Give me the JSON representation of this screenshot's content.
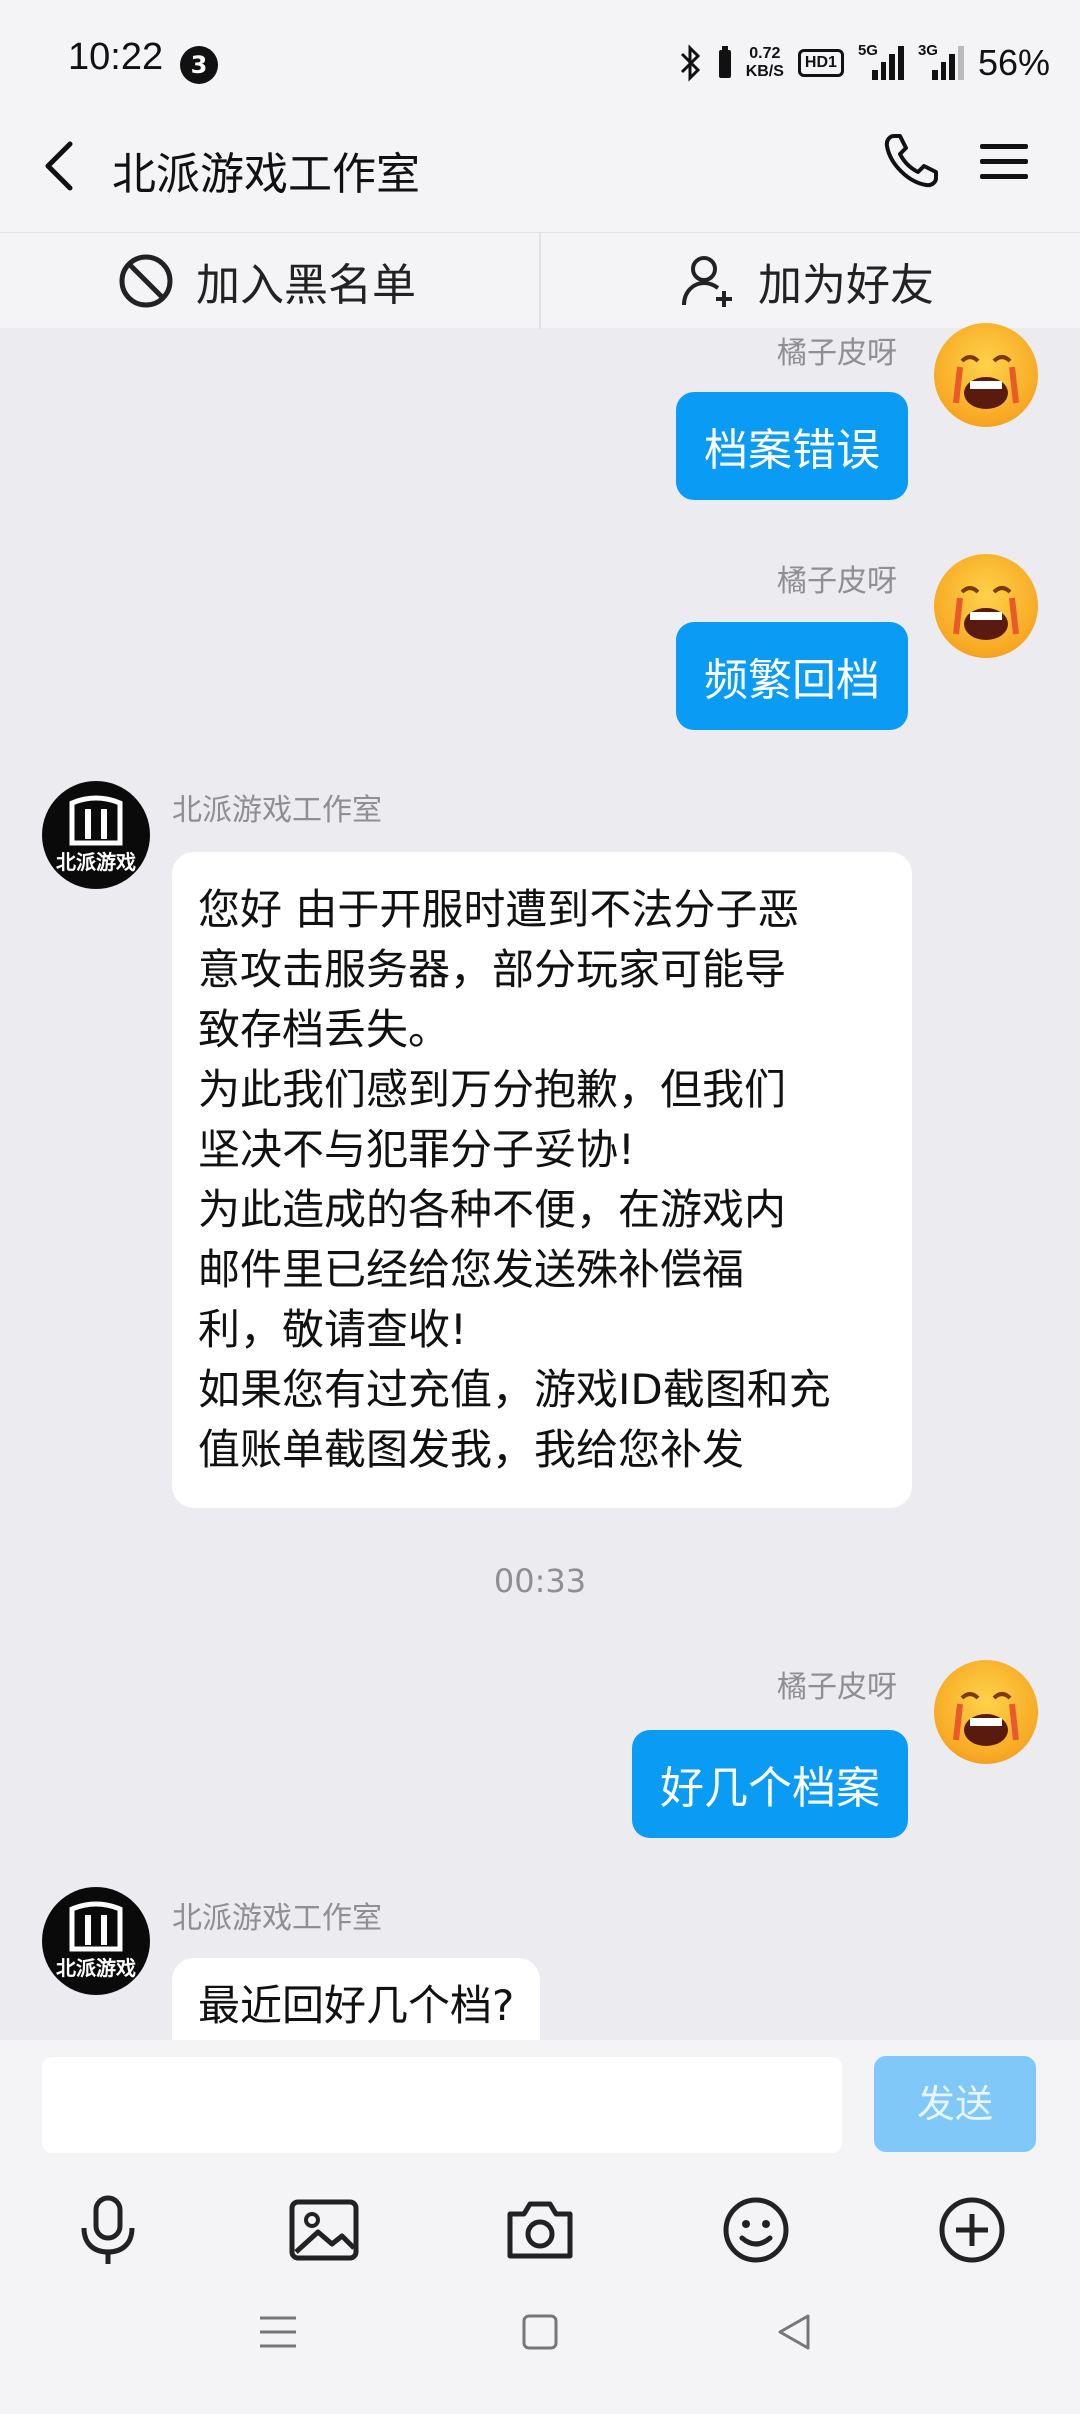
{
  "status": {
    "time": "10:22",
    "notification_count": "3",
    "net_speed_value": "0.72",
    "net_speed_unit": "KB/S",
    "hd_label": "HD1",
    "signal1_label": "5G",
    "signal2_label": "3G",
    "battery": "56%"
  },
  "header": {
    "title": "北派游戏工作室"
  },
  "actions": {
    "block": "加入黑名单",
    "add_friend": "加为好友"
  },
  "messages": {
    "m1": {
      "sender": "橘子皮呀",
      "text": "档案错误"
    },
    "m2": {
      "sender": "橘子皮呀",
      "text": "频繁回档"
    },
    "m3": {
      "sender": "北派游戏工作室",
      "lines": [
        "您好 由于开服时遭到不法分子恶",
        "意攻击服务器，部分玩家可能导",
        "致存档丢失。",
        "为此我们感到万分抱歉，但我们",
        "坚决不与犯罪分子妥协!",
        "为此造成的各种不便，在游戏内",
        "邮件里已经给您发送殊补偿福",
        "利，敬请查收!",
        "如果您有过充值，游戏ID截图和充",
        "值账单截图发我，我给您补发"
      ]
    },
    "timestamp": "00:33",
    "m4": {
      "sender": "橘子皮呀",
      "text": "好几个档案"
    },
    "m5": {
      "sender": "北派游戏工作室",
      "text": "最近回好几个档?"
    }
  },
  "studio_logo_text": "北派游戏",
  "composer": {
    "input_value": "",
    "send_label": "发送"
  },
  "colors": {
    "accent": "#0A9BF5",
    "send_disabled": "#7FC8F8",
    "background": "#EBEBF0"
  },
  "icons": {
    "toolbar": [
      "microphone-icon",
      "image-icon",
      "camera-icon",
      "emoji-icon",
      "plus-icon"
    ],
    "navbar": [
      "menu-icon",
      "home-icon",
      "back-icon"
    ]
  }
}
